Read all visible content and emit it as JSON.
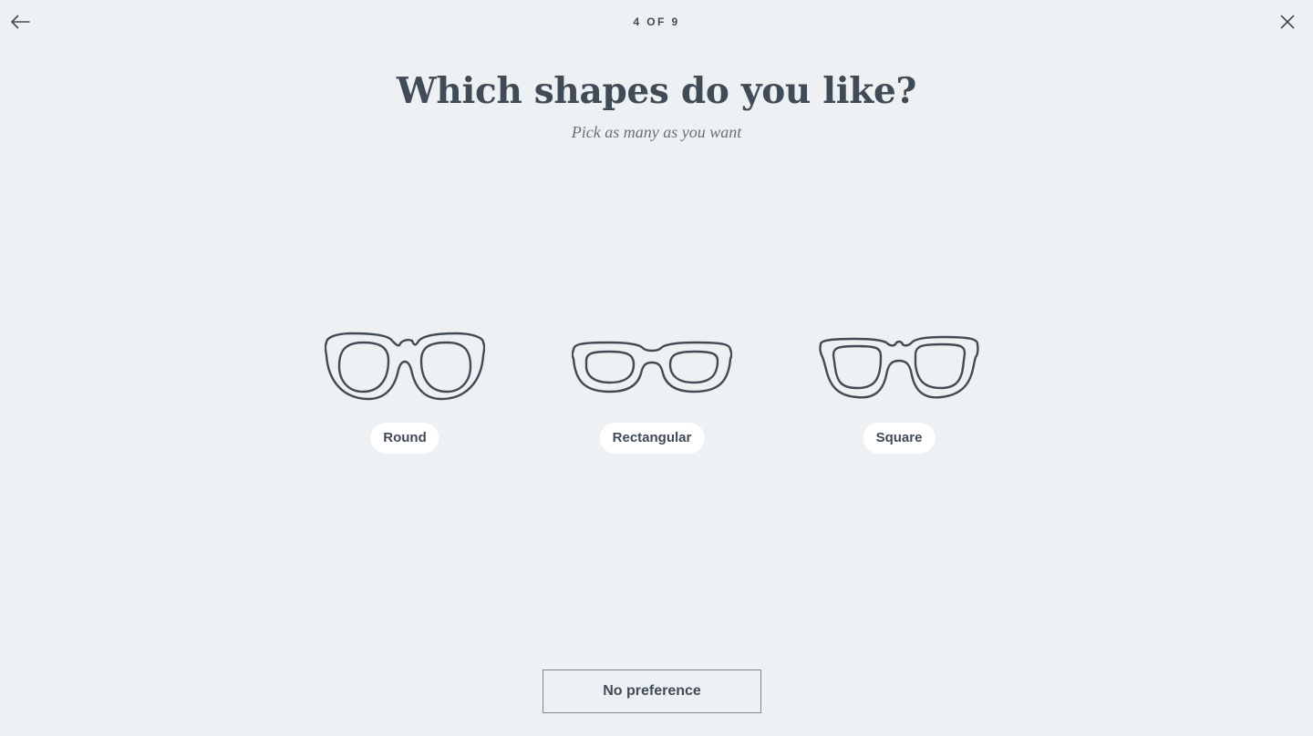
{
  "header": {
    "step": "4 OF 9",
    "back_icon": "arrow-left-icon",
    "close_icon": "close-icon"
  },
  "question": {
    "title": "Which shapes do you like?",
    "subtitle": "Pick as many as you want"
  },
  "options": [
    {
      "label": "Round",
      "icon": "round-glasses-icon"
    },
    {
      "label": "Rectangular",
      "icon": "rectangular-glasses-icon"
    },
    {
      "label": "Square",
      "icon": "square-glasses-icon"
    }
  ],
  "footer": {
    "no_preference_label": "No preference"
  },
  "colors": {
    "background": "#edf1f4",
    "text": "#414b56",
    "pill": "#ffffff"
  }
}
